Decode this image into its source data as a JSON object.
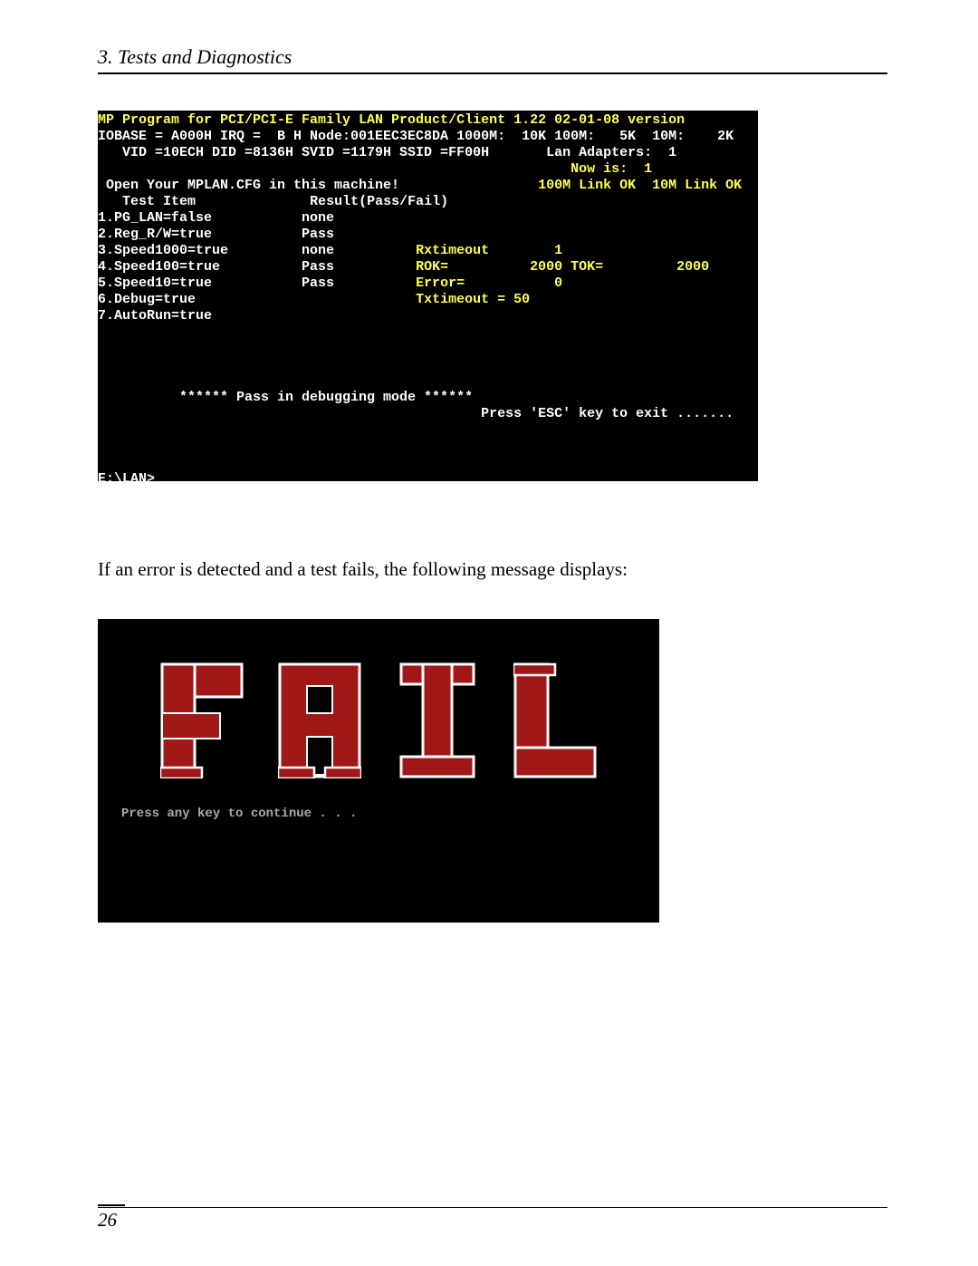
{
  "header": {
    "section": "3.  Tests and Diagnostics"
  },
  "terminal1": {
    "line_title": "MP Program for PCI/PCI-E Family LAN Product/Client 1.22 02-01-08 version",
    "line_io": "IOBASE = A000H IRQ =  B H Node:001EEC3EC8DA 1000M:  10K 100M:   5K  10M:    2K",
    "line_vid": "   VID =10ECH DID =8136H SVID =1179H SSID =FF00H       Lan Adapters:  1",
    "line_now": "                                                          Now is:  1",
    "line_open": " Open Your MPLAN.CFG in this machine!",
    "line_link": "100M Link OK  10M Link OK",
    "heading_test": "   Test Item",
    "heading_result": "Result(Pass/Fail)",
    "rows": [
      {
        "n": "1",
        "item": "PG_LAN=false",
        "result": "none",
        "extra_l": "",
        "extra_r": ""
      },
      {
        "n": "2",
        "item": "Reg_R/W=true",
        "result": "Pass",
        "extra_l": "",
        "extra_r": ""
      },
      {
        "n": "3",
        "item": "Speed1000=true",
        "result": "none",
        "extra_l": "Rxtimeout",
        "extra_r": "     1"
      },
      {
        "n": "4",
        "item": "Speed100=true",
        "result": "Pass",
        "extra_l": "ROK=",
        "extra_r": "  2000 TOK=         2000"
      },
      {
        "n": "5",
        "item": "Speed10=true",
        "result": "Pass",
        "extra_l": "Error=",
        "extra_r": "     0"
      },
      {
        "n": "6",
        "item": "Debug=true",
        "result": "",
        "extra_l": "Txtimeout = 50",
        "extra_r": ""
      },
      {
        "n": "7",
        "item": "AutoRun=true",
        "result": "",
        "extra_l": "",
        "extra_r": ""
      }
    ],
    "pass_line": "          ****** Pass in debugging mode ******",
    "esc_line": "                                               Press 'ESC' key to exit .......",
    "prompt": "E:\\LAN>"
  },
  "bodytext": "If an error is detected and a test fails, the following message displays:",
  "terminal2": {
    "fail_word": "FAIL",
    "continue": "Press any key to continue . . ."
  },
  "footer": {
    "page": "26"
  }
}
